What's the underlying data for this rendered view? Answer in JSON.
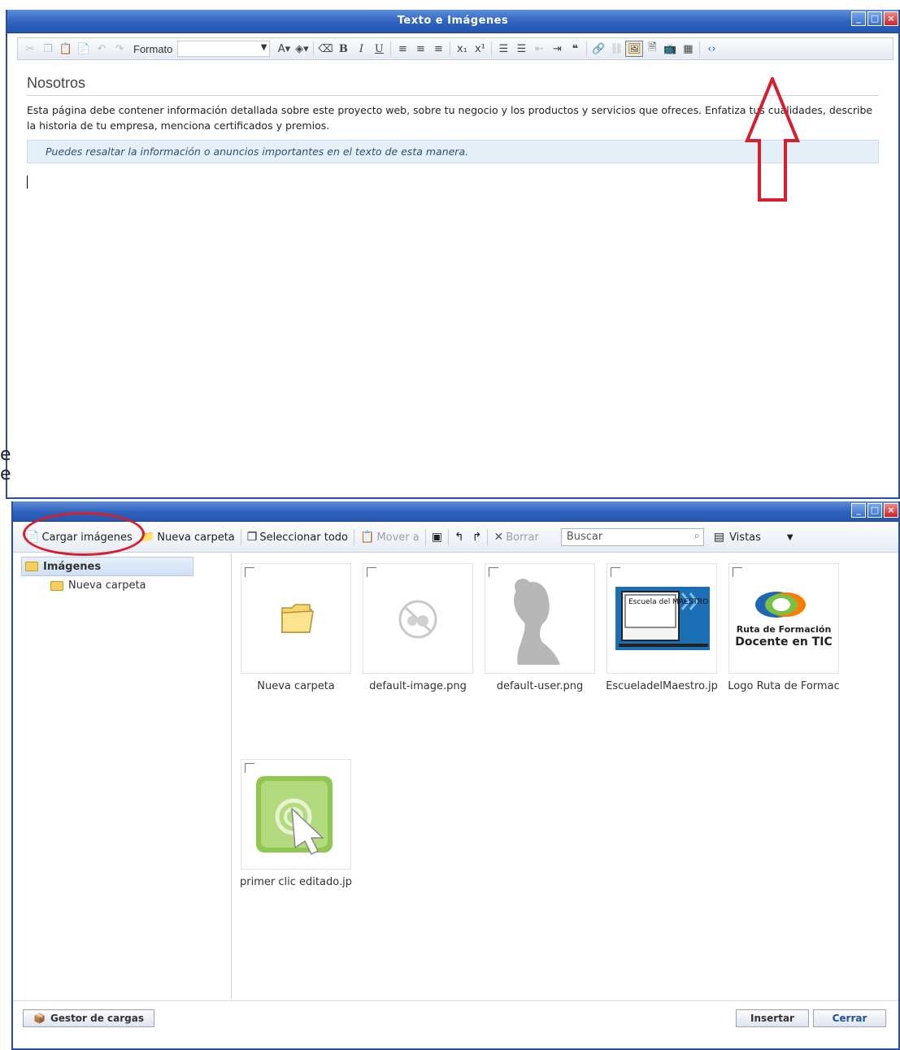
{
  "editor_window": {
    "title": "Texto e Imágenes",
    "toolbar": {
      "format_label": "Formato",
      "bold": "B",
      "italic": "I",
      "underline": "U"
    },
    "content": {
      "heading": "Nosotros",
      "paragraph": "Esta página debe contener información detallada sobre este proyecto web, sobre tu negocio y los productos y servicios que ofreces. Enfatiza tus cualidades, describe la historia de tu empresa, menciona certificados y premios.",
      "callout": "Puedes resaltar la información o anuncios importantes en el texto de esta manera."
    }
  },
  "left_edge_fragments": [
    "e",
    "e"
  ],
  "file_manager": {
    "toolbar": {
      "upload": "Cargar imágenes",
      "new_folder": "Nueva carpeta",
      "select_all": "Seleccionar todo",
      "move": "Mover a",
      "delete": "Borrar",
      "search_placeholder": "Buscar",
      "views": "Vistas"
    },
    "tree": {
      "root": "Imágenes",
      "child": "Nueva carpeta"
    },
    "items": [
      {
        "label": "Nueva carpeta",
        "icon": "folder-icon"
      },
      {
        "label": "default-image.png",
        "icon": "no-image-icon"
      },
      {
        "label": "default-user.png",
        "icon": "user-silhouette-icon"
      },
      {
        "label": "EscueladelMaestro.jp",
        "icon": "escuela-logo",
        "logo_text": "Escuela del MAESTRO"
      },
      {
        "label": "Logo Ruta de Formac",
        "icon": "ruta-logo",
        "logo_text_1": "Ruta de Formación",
        "logo_text_2": "Docente en TIC"
      },
      {
        "label": "primer clic editado.jp",
        "icon": "click-thumb-icon"
      }
    ],
    "footer": {
      "upload_manager": "Gestor de cargas",
      "insert": "Insertar",
      "close": "Cerrar"
    }
  },
  "colors": {
    "titlebar": "#2d62be",
    "annotation": "#d81e2c"
  }
}
